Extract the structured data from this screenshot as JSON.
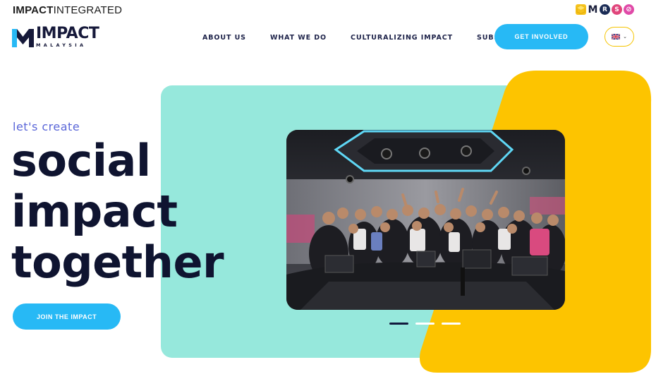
{
  "topbar": {
    "integrated_bold": "IMPACT",
    "integrated_rest": "INTEGRATED",
    "brands": [
      {
        "name": "cube-brand-icon",
        "glyph": "",
        "color": "#f6c21b"
      },
      {
        "name": "m-brand-icon",
        "glyph": "M",
        "color": "#1b1f3b"
      },
      {
        "name": "r-brand-icon",
        "glyph": "R",
        "color": "#1a2b55"
      },
      {
        "name": "s-brand-icon",
        "glyph": "S",
        "color": "#e0457b"
      },
      {
        "name": "slash-brand-icon",
        "glyph": "⊘",
        "color": "#e04aa8"
      }
    ]
  },
  "logo": {
    "main": "IMPACT",
    "sub": "MALAYSIA"
  },
  "nav": {
    "items": [
      "ABOUT US",
      "WHAT WE DO",
      "CULTURALIZING IMPACT",
      "SUBSCRIBE"
    ],
    "cta": "GET INVOLVED"
  },
  "hero": {
    "eyebrow": "let's create",
    "line1": "social",
    "line2": "impact",
    "line3": "together",
    "button": "JOIN THE IMPACT"
  },
  "slider": {
    "count": 3,
    "active_index": 0
  },
  "colors": {
    "accent_blue": "#27b9f5",
    "mint": "#96e8dc",
    "yellow": "#fdc400",
    "navy": "#0f1430",
    "eyebrow": "#5a66d8"
  }
}
